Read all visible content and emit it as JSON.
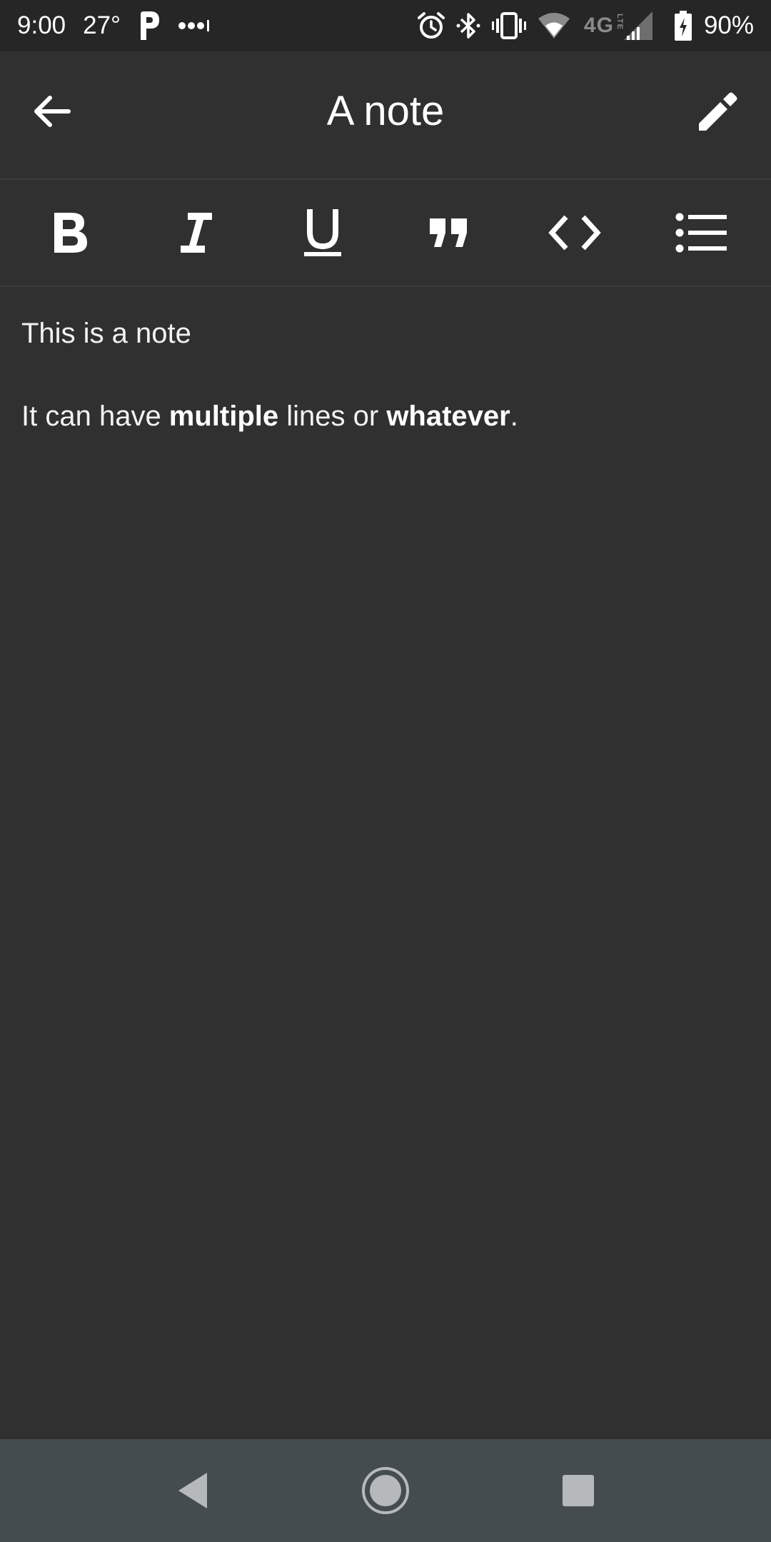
{
  "status_bar": {
    "time": "9:00",
    "temperature": "27°",
    "battery_percent": "90%",
    "network_label": "4G",
    "network_sub": "LTE",
    "left_icons": [
      "parking-app-icon",
      "more-dots-icon"
    ],
    "right_icons": [
      "alarm-icon",
      "bluetooth-icon",
      "vibrate-icon",
      "wifi-icon",
      "signal-icon",
      "battery-charging-icon"
    ]
  },
  "app_bar": {
    "title": "A note",
    "back_icon": "arrow-back-icon",
    "edit_icon": "pencil-icon"
  },
  "toolbar": {
    "tools": [
      "bold",
      "italic",
      "underline",
      "quote",
      "code",
      "bulleted-list"
    ]
  },
  "note": {
    "line1": "This is a note",
    "line2_part1": "It can have ",
    "line2_bold1": "multiple",
    "line2_part2": " lines or ",
    "line2_bold2": "whatever",
    "line2_part3": "."
  },
  "nav_bar": {
    "buttons": [
      "nav-back",
      "nav-home",
      "nav-recents"
    ]
  },
  "colors": {
    "background": "#303030",
    "status_bar": "#262626",
    "nav_bar": "#454c50",
    "icon": "#ffffff",
    "nav_icon": "#b5b9bb"
  }
}
